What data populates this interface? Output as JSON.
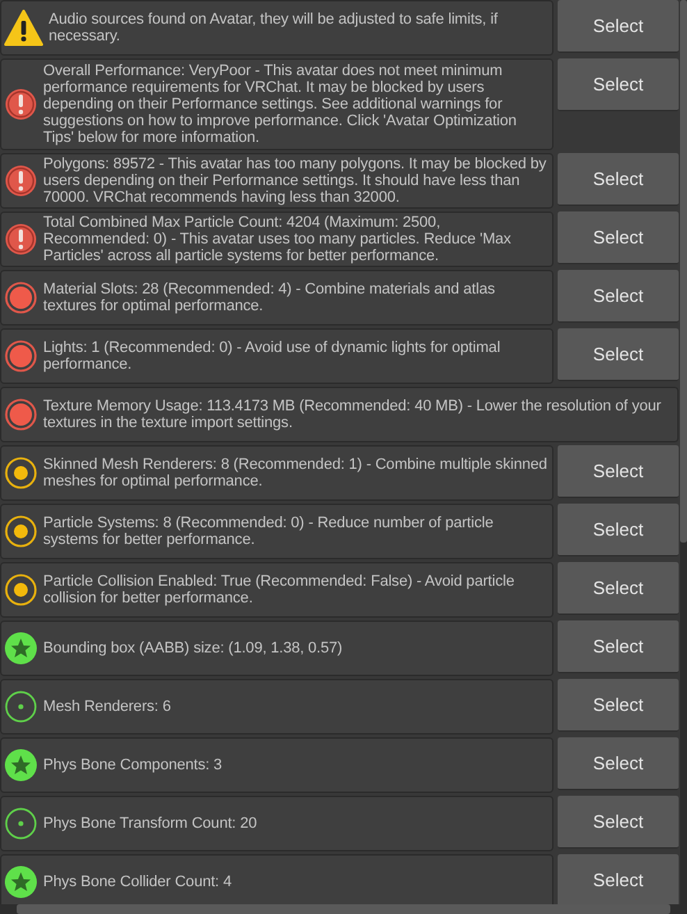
{
  "messages": [
    {
      "kind": "warning",
      "text": "Audio sources found on Avatar, they will be adjusted to safe limits, if necessary.",
      "button": "Select"
    },
    {
      "kind": "error",
      "text": "Overall Performance: VeryPoor - This avatar does not meet minimum performance requirements for VRChat. It may be blocked by users depending on their Performance settings. See additional warnings for suggestions on how to improve performance. Click 'Avatar Optimization Tips' below for more information.",
      "button": "Select"
    },
    {
      "kind": "error",
      "text": "Polygons: 89572 - This avatar has too many polygons. It may be blocked by users depending on their Performance settings. It should have less than 70000. VRChat recommends having less than 32000.",
      "button": "Select"
    },
    {
      "kind": "error",
      "text": "Total Combined Max Particle Count: 4204 (Maximum: 2500, Recommended: 0) - This avatar uses too many particles. Reduce 'Max Particles' across all particle systems for better performance.",
      "button": "Select"
    },
    {
      "kind": "poor",
      "text": "Material Slots: 28 (Recommended: 4) - Combine materials and atlas textures for optimal performance.",
      "button": "Select"
    },
    {
      "kind": "poor",
      "text": "Lights: 1 (Recommended: 0) - Avoid use of dynamic lights for optimal performance.",
      "button": "Select"
    },
    {
      "kind": "poor",
      "text": "Texture Memory Usage: 113.4173 MB (Recommended: 40 MB) - Lower the resolution of your textures in the texture import settings."
    },
    {
      "kind": "medium",
      "text": "Skinned Mesh Renderers: 8 (Recommended: 1) - Combine multiple skinned meshes for optimal performance.",
      "button": "Select"
    },
    {
      "kind": "medium",
      "text": "Particle Systems: 8 (Recommended: 0) - Reduce number of particle systems for better performance.",
      "button": "Select"
    },
    {
      "kind": "medium",
      "text": "Particle Collision Enabled: True (Recommended: False) - Avoid particle collision for better performance.",
      "button": "Select"
    },
    {
      "kind": "excellent",
      "text": "Bounding box (AABB) size: (1.09, 1.38, 0.57)",
      "button": "Select"
    },
    {
      "kind": "good",
      "text": "Mesh Renderers: 6",
      "button": "Select"
    },
    {
      "kind": "excellent",
      "text": "Phys Bone Components: 3",
      "button": "Select"
    },
    {
      "kind": "good",
      "text": "Phys Bone Transform Count: 20",
      "button": "Select"
    },
    {
      "kind": "excellent",
      "text": "Phys Bone Collider Count: 4",
      "button": "Select"
    }
  ]
}
